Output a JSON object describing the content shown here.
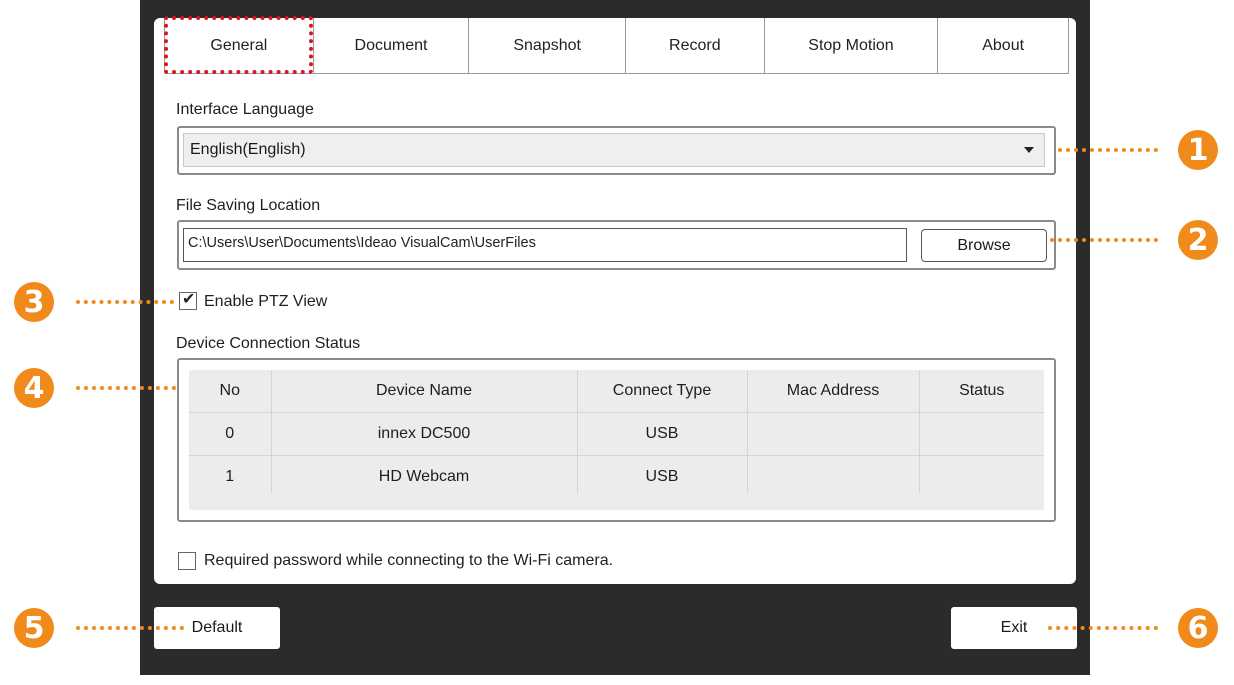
{
  "tabs": [
    {
      "label": "General"
    },
    {
      "label": "Document"
    },
    {
      "label": "Snapshot"
    },
    {
      "label": "Record"
    },
    {
      "label": "Stop Motion"
    },
    {
      "label": "About"
    }
  ],
  "language": {
    "label": "Interface Language",
    "value": "English(English)"
  },
  "file_saving": {
    "label": "File Saving Location",
    "path": "C:\\Users\\User\\Documents\\Ideao VisualCam\\UserFiles",
    "browse_label": "Browse"
  },
  "ptz": {
    "label": "Enable PTZ View",
    "checked": true
  },
  "devices": {
    "label": "Device Connection Status",
    "columns": [
      "No",
      "Device Name",
      "Connect Type",
      "Mac Address",
      "Status"
    ],
    "rows": [
      [
        "0",
        "innex DC500",
        "USB",
        "",
        ""
      ],
      [
        "1",
        "HD Webcam",
        "USB",
        "",
        ""
      ]
    ]
  },
  "wifi_password": {
    "label": "Required password while connecting to the Wi-Fi camera.",
    "checked": false
  },
  "footer": {
    "default_label": "Default",
    "exit_label": "Exit"
  },
  "callouts": [
    "1",
    "2",
    "3",
    "4",
    "5",
    "6"
  ],
  "colors": {
    "accent": "#f08a1a",
    "highlight": "#e0141e",
    "frame": "#2b2b2b"
  }
}
